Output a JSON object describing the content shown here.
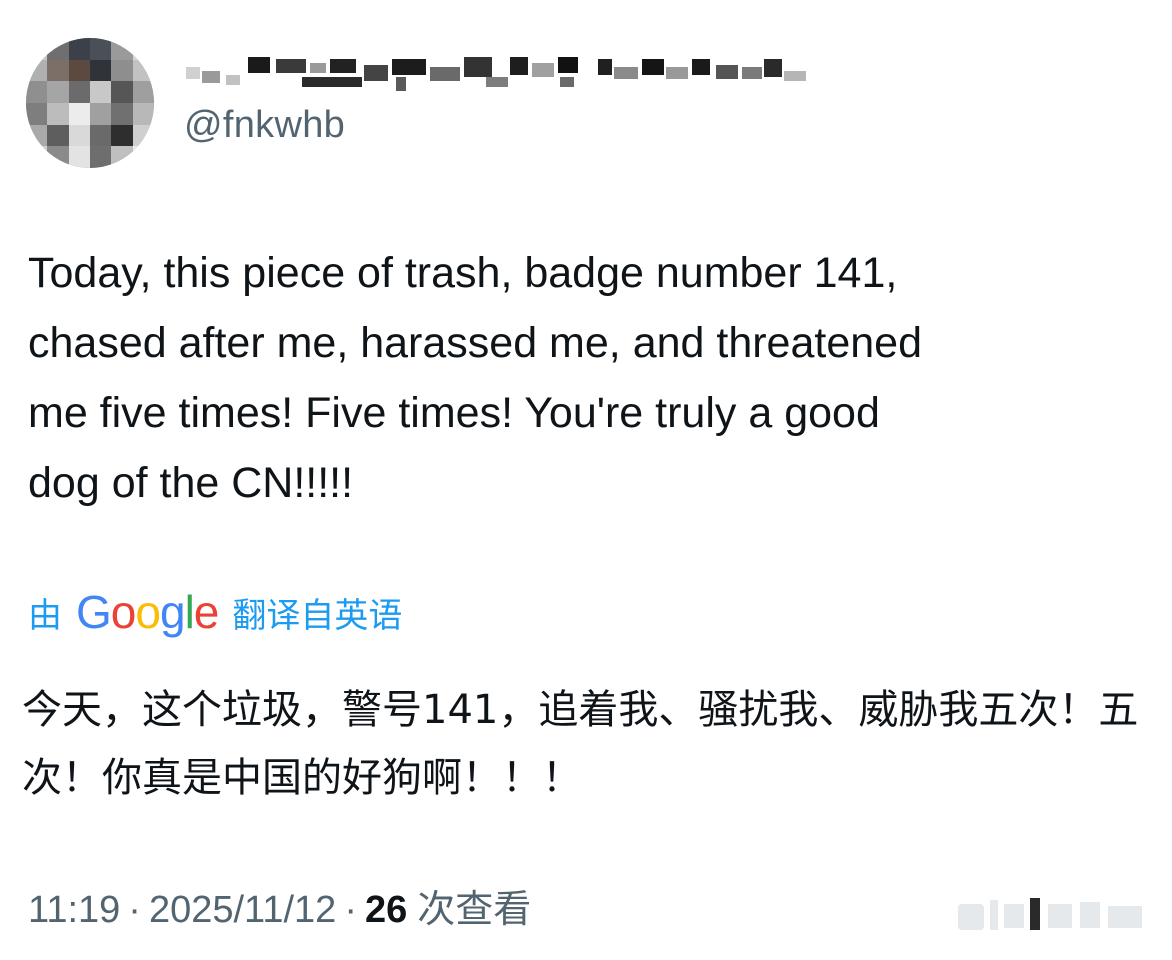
{
  "tweet": {
    "handle": "@fnkwhb",
    "text": "Today, this piece of trash, badge number 141,\nchased after me, harassed me, and threatened\nme five times! Five times! You're truly a good\ndog of the CN!!!!!",
    "translation": {
      "prefix": "由",
      "provider_letters": [
        "G",
        "o",
        "o",
        "g",
        "l",
        "e"
      ],
      "suffix": "翻译自英语",
      "text": "今天，这个垃圾，警号141，追着我、骚扰我、威胁我五次！五次！你真是中国的好狗啊！！！"
    },
    "meta": {
      "time": "11:19",
      "separator": "·",
      "date": "2025/11/12",
      "views_count": "26",
      "views_label": "次查看"
    }
  }
}
